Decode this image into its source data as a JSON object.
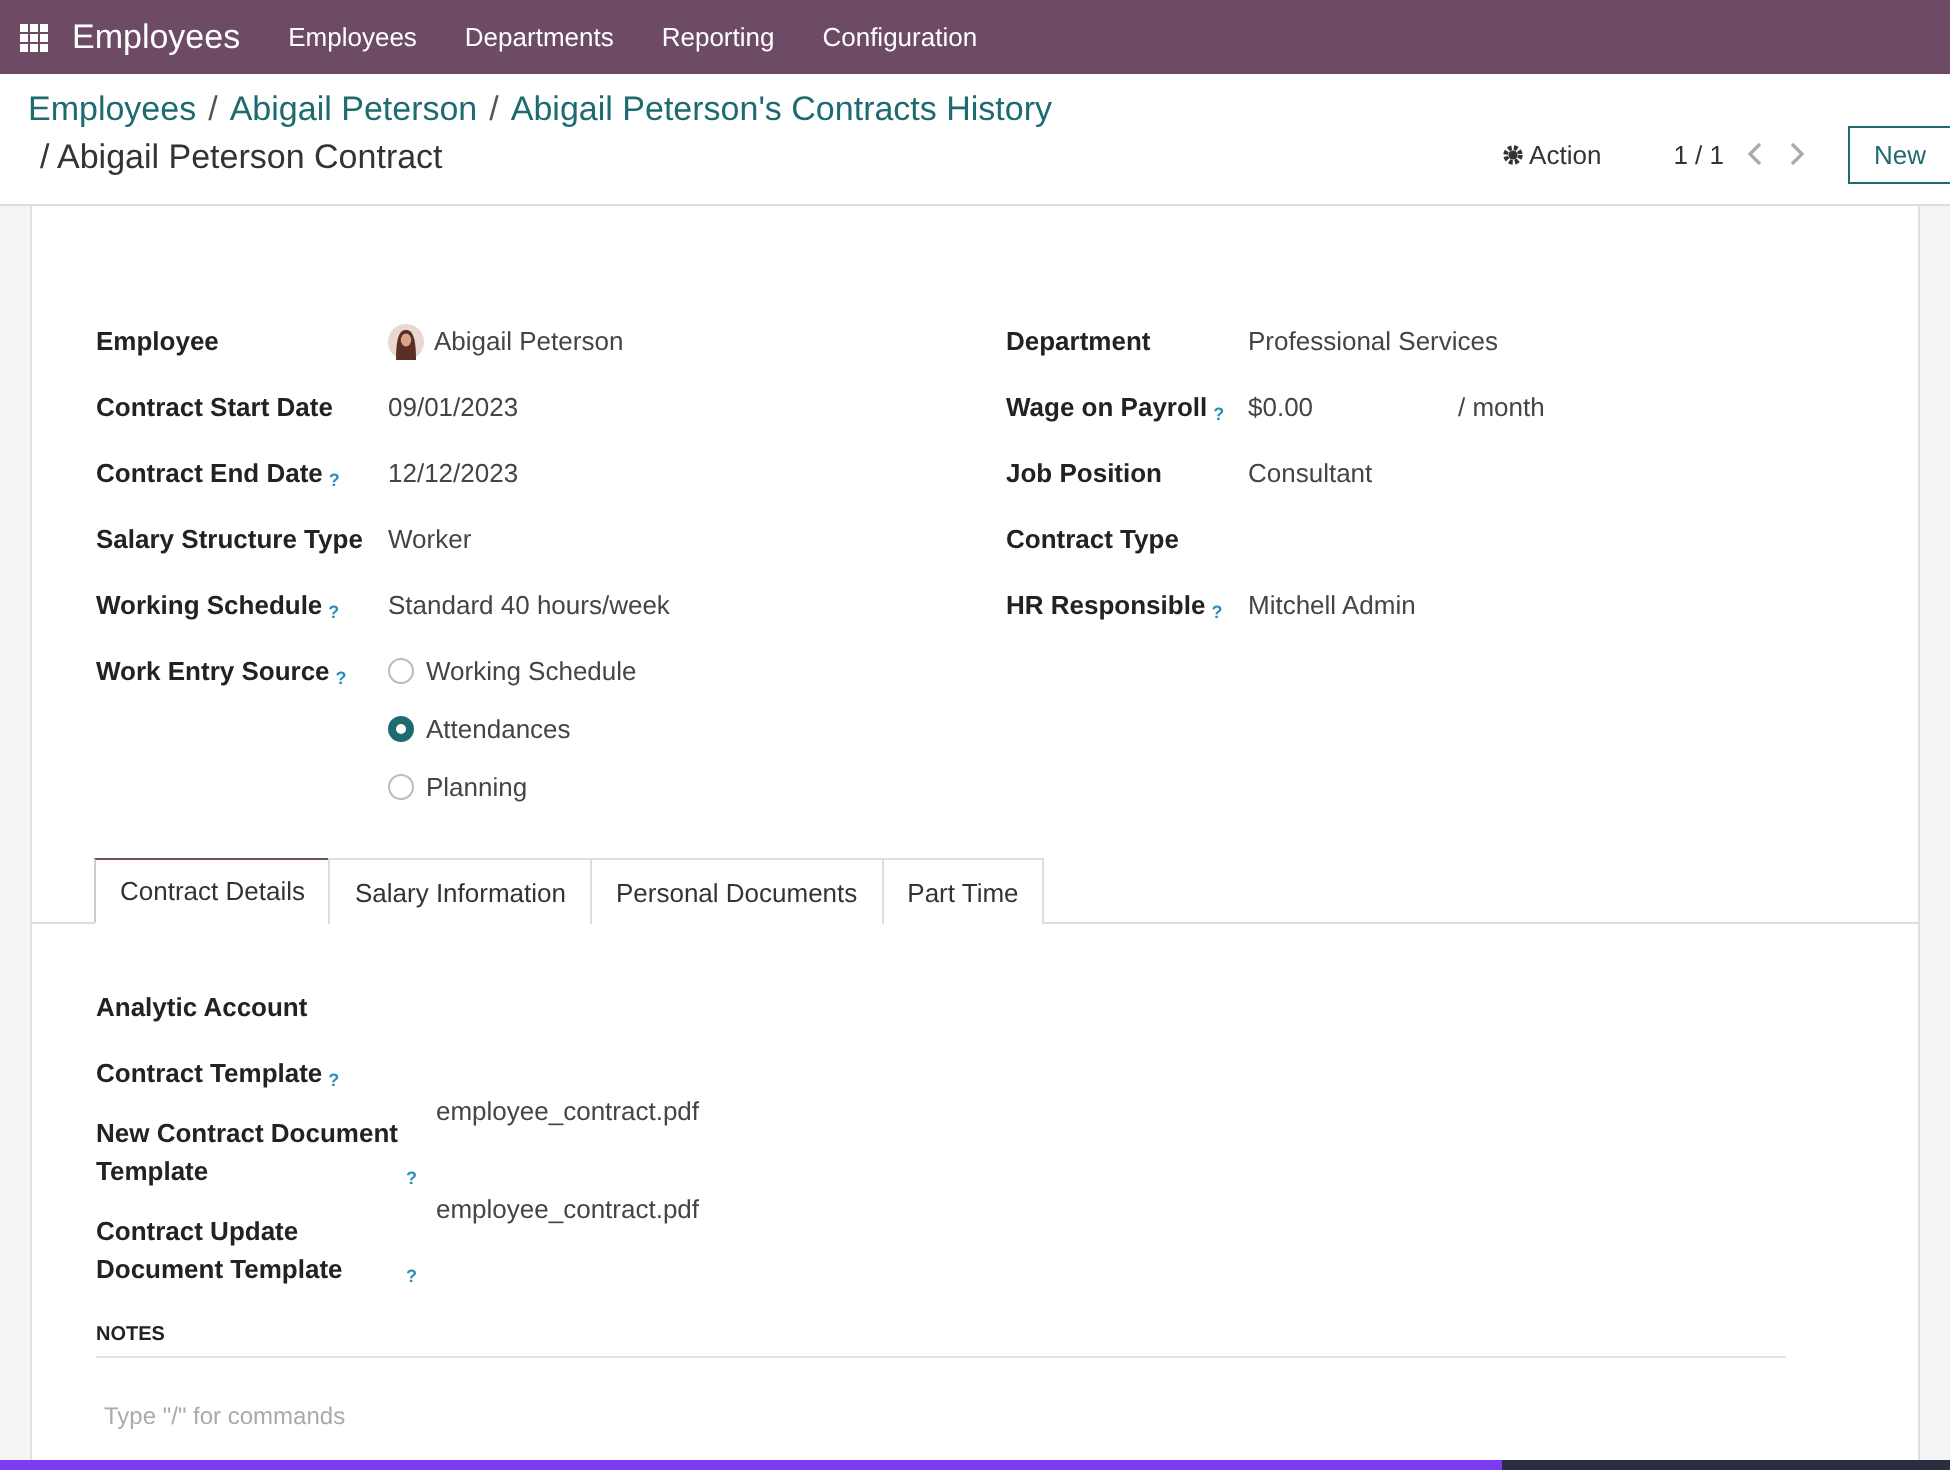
{
  "navbar": {
    "app": "Employees",
    "menu": [
      "Employees",
      "Departments",
      "Reporting",
      "Configuration"
    ]
  },
  "breadcrumbs": [
    {
      "label": "Employees"
    },
    {
      "separator": "/",
      "label": "Abigail Peterson"
    },
    {
      "separator": "/",
      "label": "Abigail Peterson's Contracts History"
    }
  ],
  "record_title": "/ Abigail Peterson Contract",
  "action": "Action",
  "pager": "1 / 1",
  "new_button": "New",
  "left_fields": [
    {
      "kind": "avatar",
      "label": "Employee",
      "value": "Abigail Peterson"
    },
    {
      "kind": "text",
      "label": "Contract Start Date",
      "value": "09/01/2023"
    },
    {
      "kind": "text",
      "label": "Contract End Date",
      "value": "12/12/2023",
      "help": "?"
    },
    {
      "kind": "text",
      "label": "Salary Structure Type",
      "value": "Worker"
    },
    {
      "kind": "text",
      "label": "Working Schedule",
      "value": "Standard 40 hours/week",
      "help": "?"
    },
    {
      "kind": "radio",
      "label": "Work Entry Source",
      "help": "?",
      "options": [
        {
          "label": "Working Schedule",
          "selected": false
        },
        {
          "label": "Attendances",
          "selected": true
        },
        {
          "label": "Planning",
          "selected": false
        }
      ]
    }
  ],
  "right_fields": [
    {
      "kind": "text",
      "label": "Department",
      "value": "Professional Services"
    },
    {
      "kind": "wage",
      "label": "Wage on Payroll",
      "value": "$0.00",
      "unit": "/ month",
      "help": "?"
    },
    {
      "kind": "text",
      "label": "Job Position",
      "value": "Consultant"
    },
    {
      "kind": "text",
      "label": "Contract Type"
    },
    {
      "kind": "text",
      "label": "HR Responsible",
      "value": "Mitchell Admin",
      "help": "?"
    }
  ],
  "tabs": [
    {
      "label": "Contract Details",
      "selected": true
    },
    {
      "label": "Salary Information",
      "selected": false
    },
    {
      "label": "Personal Documents",
      "selected": false
    },
    {
      "label": "Part Time",
      "selected": false
    }
  ],
  "tab_fields": [
    {
      "label": "Analytic Account"
    },
    {
      "label": "Contract Template",
      "help": "?"
    },
    {
      "label": "New Contract Document Template",
      "value": "employee_contract.pdf",
      "help": "?"
    },
    {
      "label": "Contract Update Document Template",
      "value": "employee_contract.pdf",
      "help": "?"
    }
  ],
  "notes": {
    "heading": "NOTES",
    "placeholder": "Type \"/\" for commands"
  },
  "loading_bar": {
    "level": 0.77
  }
}
